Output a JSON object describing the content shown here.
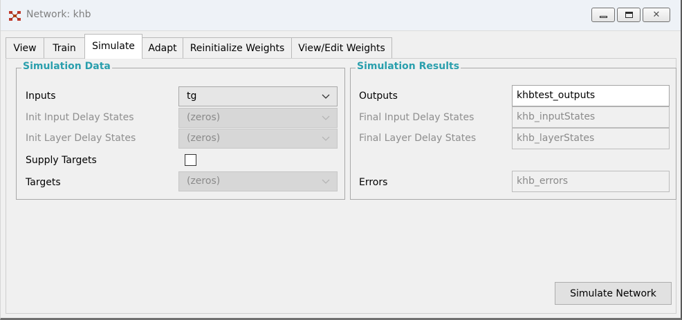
{
  "window": {
    "title": "Network: khb",
    "icon": "network-icon",
    "controls": {
      "minimize": "minimize-icon",
      "maximize": "maximize-icon",
      "close": "close-icon"
    }
  },
  "tabs": [
    {
      "label": "View"
    },
    {
      "label": "Train"
    },
    {
      "label": "Simulate",
      "active": true
    },
    {
      "label": "Adapt"
    },
    {
      "label": "Reinitialize Weights"
    },
    {
      "label": "View/Edit Weights"
    }
  ],
  "simulation_data": {
    "title": "Simulation Data",
    "inputs": {
      "label": "Inputs",
      "value": "tg"
    },
    "init_input_delay": {
      "label": "Init Input Delay States",
      "value": "(zeros)"
    },
    "init_layer_delay": {
      "label": "Init Layer Delay States",
      "value": "(zeros)"
    },
    "supply_targets": {
      "label": "Supply Targets",
      "checked": false
    },
    "targets": {
      "label": "Targets",
      "value": "(zeros)"
    }
  },
  "simulation_results": {
    "title": "Simulation Results",
    "outputs": {
      "label": "Outputs",
      "value": "khbtest_outputs"
    },
    "final_input_delay": {
      "label": "Final Input Delay States",
      "value": "khb_inputStates"
    },
    "final_layer_delay": {
      "label": "Final Layer Delay States",
      "value": "khb_layerStates"
    },
    "errors": {
      "label": "Errors",
      "value": "khb_errors"
    }
  },
  "actions": {
    "simulate_label": "Simulate Network"
  },
  "colors": {
    "group_title": "#2a9fad",
    "disabled_text": "#8e8e8e"
  }
}
